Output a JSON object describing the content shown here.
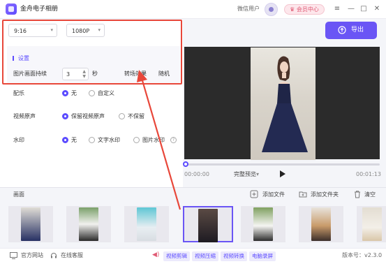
{
  "app": {
    "title": "金舟电子相册",
    "user": "微信用户",
    "vip": "会员中心"
  },
  "window": {
    "minimize": "—",
    "restore": "☐",
    "maximize": "□",
    "close": "✕",
    "menu": "≡"
  },
  "left": {
    "aspect": "9:16",
    "resolution": "1080P",
    "settings_label": "设置",
    "duration_label": "图片画面持续",
    "duration_value": "3",
    "duration_unit": "秒",
    "transition_label": "转场效果",
    "transition_value": "随机",
    "music_label": "配乐",
    "music_opts": [
      "无",
      "自定义"
    ],
    "audio_label": "视频原声",
    "audio_opts": [
      "保留视频原声",
      "不保留"
    ],
    "watermark_label": "水印",
    "watermark_opts": [
      "无",
      "文字水印",
      "图片水印"
    ]
  },
  "export_label": "导出",
  "player": {
    "time_start": "00:00:00",
    "preview": "完整预览",
    "time_end": "00:01:13",
    "progress": 0.02
  },
  "strip": {
    "title": "画面",
    "add_file": "添加文件",
    "add_folder": "添加文件夹",
    "clear": "清空"
  },
  "status": {
    "site": "官方网站",
    "service": "在线客服",
    "tools": [
      "视频剪辑",
      "视频压缩",
      "视频转换",
      "电脑录屏"
    ],
    "version": "版本号：v2.3.0"
  },
  "colors": {
    "accent": "#6a55f5",
    "annotation": "#e8473a"
  },
  "icons": [
    "app-logo-icon",
    "avatar-icon",
    "vip-icon",
    "menu-icon",
    "minimize-icon",
    "maximize-icon",
    "close-icon",
    "chevron-down-icon",
    "export-icon",
    "play-icon",
    "add-file-icon",
    "add-folder-icon",
    "trash-icon",
    "monitor-icon",
    "headset-icon",
    "help-icon"
  ]
}
